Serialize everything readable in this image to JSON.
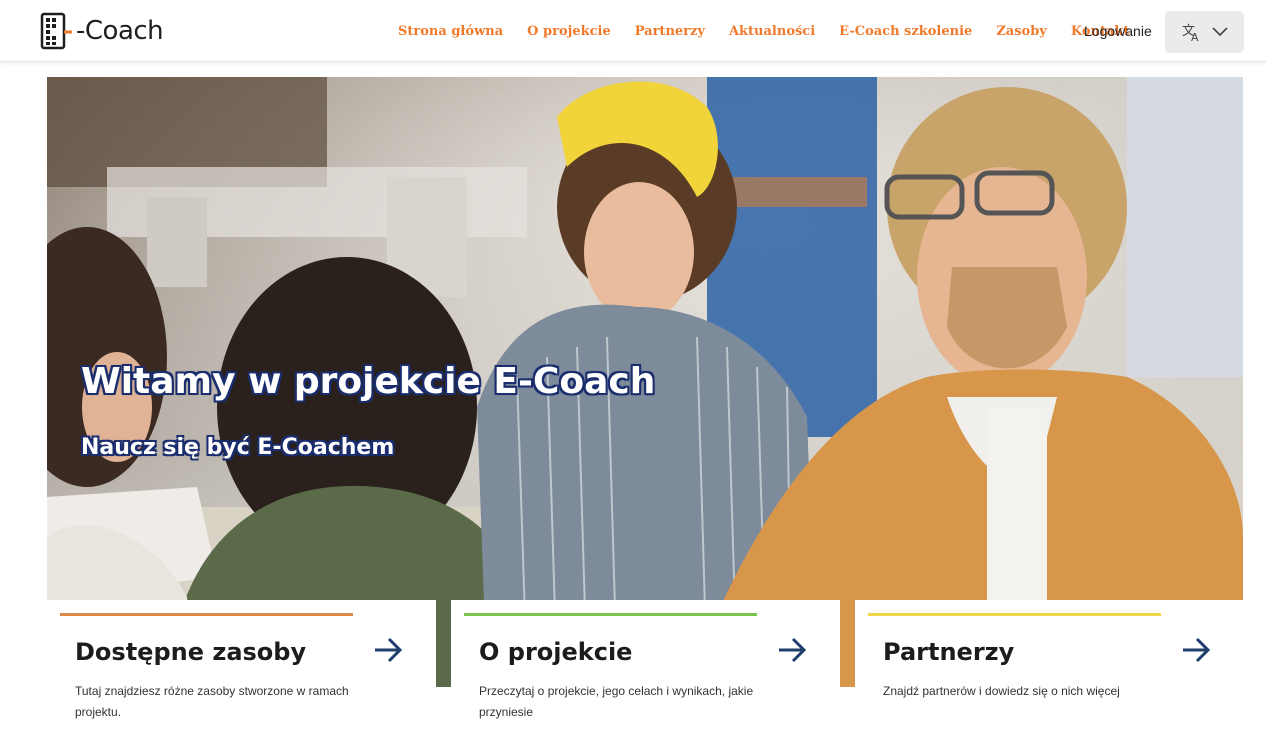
{
  "header": {
    "logo_text": "-Coach",
    "nav": [
      "Strona główna",
      "O projekcie",
      "Partnerzy",
      "Aktualności",
      "E-Coach szkolenie",
      "Zasoby",
      "Kontakt"
    ],
    "login_label": "Logowanie",
    "language_icon": "translate-icon",
    "dropdown_icon": "chevron-down-icon"
  },
  "hero": {
    "title": "Witamy w projekcie E-Coach",
    "subtitle": "Naucz się być E-Coachem"
  },
  "cards": [
    {
      "title": "Dostępne zasoby",
      "description": "Tutaj znajdziesz różne zasoby stworzone w ramach projektu.",
      "accent": "#e08a47",
      "icon": "arrow-right-icon"
    },
    {
      "title": "O projekcie",
      "description": "Przeczytaj o projekcie, jego celach i wynikach, jakie przyniesie",
      "accent": "#7cc24e",
      "icon": "arrow-right-icon"
    },
    {
      "title": "Partnerzy",
      "description": "Znajdź partnerów i dowiedz się o nich więcej",
      "accent": "#f2d64a",
      "icon": "arrow-right-icon"
    }
  ],
  "colors": {
    "nav": "#f07a2b",
    "arrow": "#1f3f6b",
    "title_outline": "#1b2e6e"
  }
}
